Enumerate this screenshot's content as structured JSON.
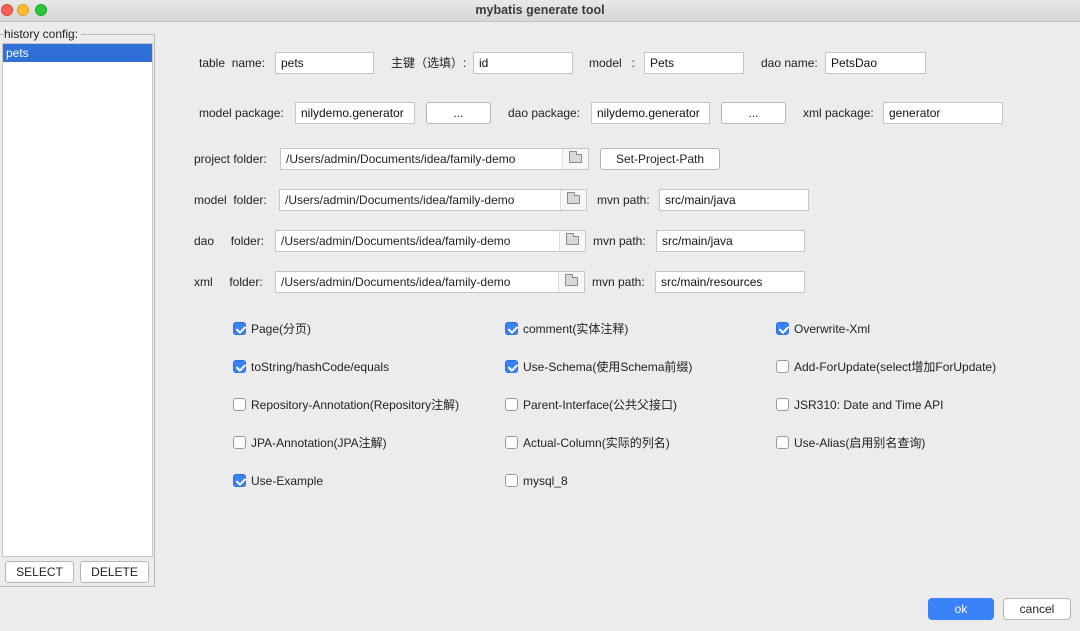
{
  "window": {
    "title": "mybatis generate tool"
  },
  "history": {
    "label": "history config:",
    "items": [
      "pets"
    ],
    "select_label": "SELECT",
    "delete_label": "DELETE"
  },
  "row1": {
    "table_name_label": "table  name:",
    "table_name_value": "pets",
    "pk_label": "主键（选填）:",
    "pk_value": "id",
    "model_label": "model   :",
    "model_value": "Pets",
    "dao_name_label": "dao name:",
    "dao_name_value": "PetsDao"
  },
  "row2": {
    "model_package_label": "model package:",
    "model_package_value": "nilydemo.generator",
    "browse_label": "...",
    "dao_package_label": "dao package:",
    "dao_package_value": "nilydemo.generator",
    "xml_package_label": "xml package:",
    "xml_package_value": "generator"
  },
  "project": {
    "label": "project folder:",
    "value": "/Users/admin/Documents/idea/family-demo",
    "set_button": "Set-Project-Path"
  },
  "model_folder": {
    "label": "model  folder:",
    "value": "/Users/admin/Documents/idea/family-demo",
    "mvn_label": "mvn path:",
    "mvn_value": "src/main/java"
  },
  "dao_folder": {
    "label": "dao     folder:",
    "value": "/Users/admin/Documents/idea/family-demo",
    "mvn_label": "mvn path:",
    "mvn_value": "src/main/java"
  },
  "xml_folder": {
    "label": "xml     folder:",
    "value": "/Users/admin/Documents/idea/family-demo",
    "mvn_label": "mvn path:",
    "mvn_value": "src/main/resources"
  },
  "options": [
    {
      "label": "Page(分页)",
      "checked": true
    },
    {
      "label": "comment(实体注释)",
      "checked": true
    },
    {
      "label": "Overwrite-Xml",
      "checked": true
    },
    {
      "label": "toString/hashCode/equals",
      "checked": true
    },
    {
      "label": "Use-Schema(使用Schema前缀)",
      "checked": true
    },
    {
      "label": "Add-ForUpdate(select增加ForUpdate)",
      "checked": false
    },
    {
      "label": "Repository-Annotation(Repository注解)",
      "checked": false
    },
    {
      "label": "Parent-Interface(公共父接口)",
      "checked": false
    },
    {
      "label": "JSR310: Date and Time API",
      "checked": false
    },
    {
      "label": "JPA-Annotation(JPA注解)",
      "checked": false
    },
    {
      "label": "Actual-Column(实际的列名)",
      "checked": false
    },
    {
      "label": "Use-Alias(启用别名查询)",
      "checked": false
    },
    {
      "label": "Use-Example",
      "checked": true
    },
    {
      "label": "mysql_8",
      "checked": false
    }
  ],
  "footer": {
    "ok_label": "ok",
    "cancel_label": "cancel"
  },
  "colors": {
    "accent": "#3a82f7",
    "selection": "#2f6fd6",
    "background": "#ececec"
  }
}
